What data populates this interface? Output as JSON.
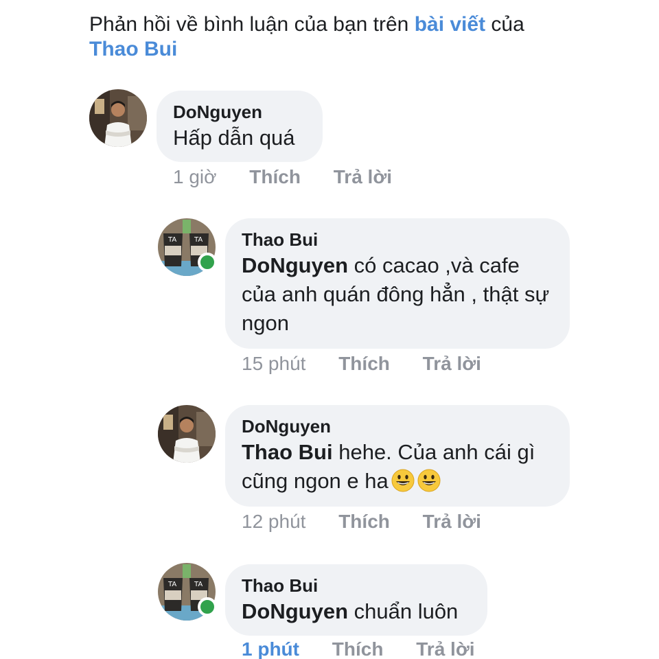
{
  "header": {
    "prefix": "Phản hồi về bình luận của bạn trên ",
    "post_link": "bài viết",
    "middle": " của ",
    "author_link": "Thao Bui"
  },
  "comments": [
    {
      "author": "DoNguyen",
      "mention": "",
      "text": "Hấp dẫn quá",
      "time": "1 giờ",
      "like": "Thích",
      "reply": "Trả lời"
    },
    {
      "author": "Thao Bui",
      "mention": "DoNguyen",
      "text": " có cacao ,và cafe của anh quán đông hẳn , thật sự ngon",
      "time": "15 phút",
      "like": "Thích",
      "reply": "Trả lời",
      "online": true
    },
    {
      "author": "DoNguyen",
      "mention": "Thao Bui",
      "text": " hehe. Của anh cái gì cũng ngon e ha",
      "emoji": [
        "grinning-face-icon",
        "grinning-face-icon"
      ],
      "time": "12 phút",
      "like": "Thích",
      "reply": "Trả lời"
    },
    {
      "author": "Thao Bui",
      "mention": "DoNguyen",
      "text": " chuẩn luôn",
      "time": "1 phút",
      "like": "Thích",
      "reply": "Trả lời",
      "online": true
    }
  ],
  "colors": {
    "link": "#4a8bd8",
    "bubble": "#f0f2f5",
    "meta": "#90949c",
    "online": "#31a24c"
  }
}
